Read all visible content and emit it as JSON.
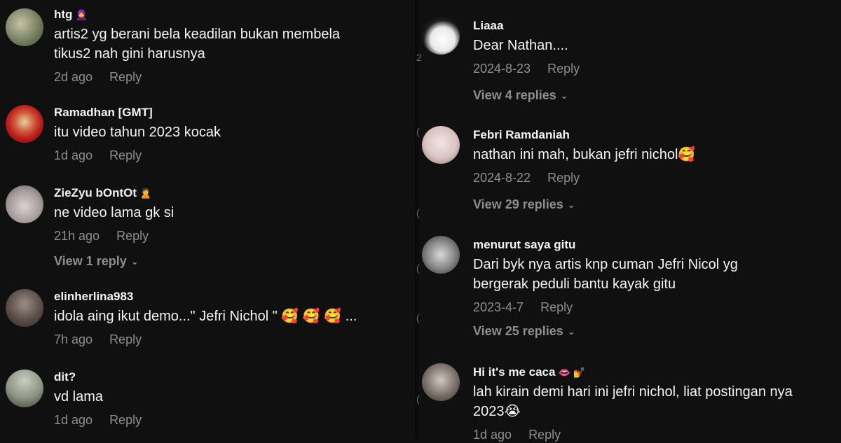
{
  "left_comments": [
    {
      "user": "htg",
      "badge": "🧕",
      "text": [
        "artis2 yg berani bela keadilan bukan membela",
        "tikus2 nah gini harusnya"
      ],
      "time": "2d ago",
      "reply": "Reply"
    },
    {
      "user": "Ramadhan [GMT]",
      "badge": "",
      "text": [
        "itu video tahun 2023 kocak"
      ],
      "time": "1d ago",
      "reply": "Reply"
    },
    {
      "user": "ZieZyu bOntOt",
      "badge": "🙎",
      "text": [
        "ne video lama gk si"
      ],
      "time": "21h ago",
      "reply": "Reply",
      "view_replies": "View 1 reply"
    },
    {
      "user": "elinherlina983",
      "badge": "",
      "text": [
        "idola aing ikut demo...\" Jefri Nichol \"  🥰 🥰 🥰 ..."
      ],
      "time": "7h ago",
      "reply": "Reply"
    },
    {
      "user": "dit?",
      "badge": "",
      "text": [
        "vd lama"
      ],
      "time": "1d ago",
      "reply": "Reply"
    }
  ],
  "right_comments": [
    {
      "user": "Liaaa",
      "badge": "",
      "text": [
        "Dear Nathan...."
      ],
      "time": "2024-8-23",
      "reply": "Reply",
      "view_replies": "View 4 replies"
    },
    {
      "user": "Febri Ramdaniah",
      "badge": "",
      "text": [
        "nathan ini mah, bukan jefri nichol🥰"
      ],
      "time": "2024-8-22",
      "reply": "Reply",
      "view_replies": "View 29 replies"
    },
    {
      "user": "menurut saya gitu",
      "badge": "",
      "text": [
        "Dari byk nya artis knp cuman Jefri Nicol yg",
        "bergerak peduli bantu kayak gitu"
      ],
      "time": "2023-4-7",
      "reply": "Reply",
      "view_replies": "View 25 replies"
    },
    {
      "user": "Hi it's me caca",
      "badge": "👄 💅",
      "text": [
        "lah kirain demi hari ini jefri nichol, liat postingan nya",
        "2023😭"
      ],
      "time": "1d ago",
      "reply": "Reply"
    }
  ],
  "edge_marks": [
    "2",
    "(",
    "(",
    "(",
    "(",
    "("
  ],
  "chevron": "⌄",
  "colors": {
    "background": "#101010",
    "text": "#f4f4f4",
    "muted": "#8e8e8e"
  }
}
